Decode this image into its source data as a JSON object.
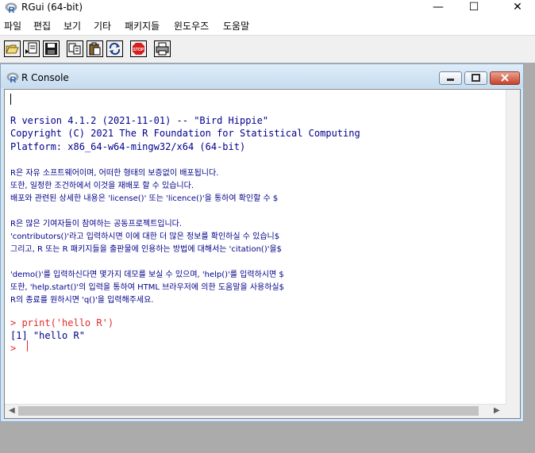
{
  "window": {
    "title": "RGui (64-bit)",
    "minimize": "—",
    "maximize": "☐",
    "close": "✕"
  },
  "menu": [
    "파일",
    "편집",
    "보기",
    "기타",
    "패키지들",
    "윈도우즈",
    "도움말"
  ],
  "toolbar": {
    "buttons": [
      "open-script",
      "load-workspace",
      "save-workspace",
      "copy",
      "copy-paste",
      "refresh",
      "stop",
      "print"
    ],
    "stop_label": "STOP"
  },
  "console": {
    "title": "R Console",
    "lines": [
      "R version 4.1.2 (2021-11-01) -- \"Bird Hippie\"",
      "Copyright (C) 2021 The R Foundation for Statistical Computing",
      "Platform: x86_64-w64-mingw32/x64 (64-bit)",
      "R은 자유 소프트웨어이며, 어떠한 형태의 보증없이 배포됩니다.",
      "또한, 일정한 조건하에서 이것을 재배포 할 수 있습니다.",
      "배포와 관련된 상세한 내용은 'license()' 또는 'licence()'을 통하여 확인할 수 $",
      "R은 많은 기여자들이 참여하는 공동프로젝트입니다.",
      "'contributors()'라고 입력하시면 이에 대한 더 많은 정보를 확인하실 수 있습니$",
      "그리고, R 또는 R 패키지들을 출판물에 인용하는 방법에 대해서는 'citation()'을$",
      "'demo()'를 입력하신다면 몇가지 데모를 보실 수 있으며, 'help()'를 입력하시면 $",
      "또한, 'help.start()'의 입력을 통하여 HTML 브라우저에 의한 도움말을 사용하실$",
      "R의 종료를 원하시면 'q()'을 입력해주세요."
    ],
    "command": "> print('hello R')",
    "output": "[1] \"hello R\"",
    "prompt": ">"
  },
  "colors": {
    "output_text": "#00008b",
    "command_text": "#e52a2a",
    "window_frame": "#d4e6f5",
    "mdi_background": "#ababab"
  }
}
